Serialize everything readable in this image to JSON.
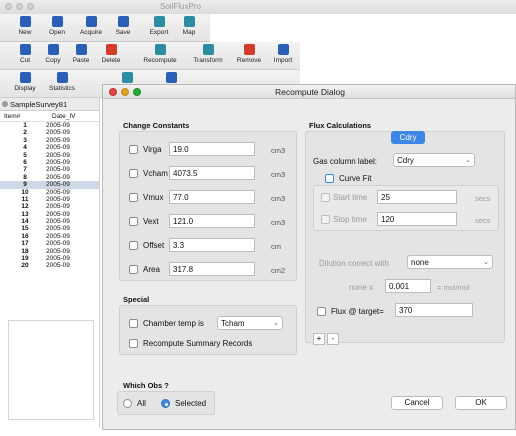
{
  "app": {
    "title": "SoilFluxPro"
  },
  "toolbar_row1": [
    {
      "label": "New",
      "icon": "new-file-icon"
    },
    {
      "label": "Open",
      "icon": "open-folder-icon"
    },
    {
      "label": "Acquire",
      "icon": "acquire-icon"
    },
    {
      "label": "Save",
      "icon": "save-icon"
    },
    {
      "label": "Export",
      "icon": "export-icon"
    },
    {
      "label": "Map",
      "icon": "map-icon"
    }
  ],
  "toolbar_row2": [
    {
      "label": "Cut",
      "icon": "scissors-icon"
    },
    {
      "label": "Copy",
      "icon": "copy-icon"
    },
    {
      "label": "Paste",
      "icon": "paste-icon"
    },
    {
      "label": "Delete",
      "icon": "delete-x-icon"
    },
    {
      "label": "Recompute",
      "icon": "recompute-icon"
    },
    {
      "label": "Transform",
      "icon": "transform-icon"
    },
    {
      "label": "Remove",
      "icon": "remove-icon"
    },
    {
      "label": "Import",
      "icon": "import-icon"
    }
  ],
  "toolbar_row3": [
    {
      "label": "Display",
      "icon": "pencil-icon"
    },
    {
      "label": "Statistics",
      "icon": "sigma-icon"
    }
  ],
  "sidebar": {
    "survey_tab": "SampleSurvey81",
    "columns": [
      "Item#",
      "Date_IV"
    ],
    "rows": [
      [
        "1",
        "2005-09"
      ],
      [
        "2",
        "2005-09"
      ],
      [
        "3",
        "2005-09"
      ],
      [
        "4",
        "2005-09"
      ],
      [
        "5",
        "2005-09"
      ],
      [
        "6",
        "2005-09"
      ],
      [
        "7",
        "2005-09"
      ],
      [
        "8",
        "2005-09"
      ],
      [
        "9",
        "2005-09"
      ],
      [
        "10",
        "2005-09"
      ],
      [
        "11",
        "2005-09"
      ],
      [
        "12",
        "2005-09"
      ],
      [
        "13",
        "2005-09"
      ],
      [
        "14",
        "2005-09"
      ],
      [
        "15",
        "2005-09"
      ],
      [
        "16",
        "2005-09"
      ],
      [
        "17",
        "2005-09"
      ],
      [
        "18",
        "2005-09"
      ],
      [
        "19",
        "2005-09"
      ],
      [
        "20",
        "2005-09"
      ]
    ],
    "selected_row": "9"
  },
  "dialog": {
    "title": "Recompute Dialog",
    "change_constants": {
      "label": "Change Constants",
      "items": [
        {
          "name": "Virga",
          "value": "19.0",
          "unit": "cm3"
        },
        {
          "name": "Vcham",
          "value": "4073.5",
          "unit": "cm3"
        },
        {
          "name": "Vmux",
          "value": "77.0",
          "unit": "cm3"
        },
        {
          "name": "Vext",
          "value": "121.0",
          "unit": "cm3"
        },
        {
          "name": "Offset",
          "value": "3.3",
          "unit": "cm"
        },
        {
          "name": "Area",
          "value": "317.8",
          "unit": "cm2"
        }
      ]
    },
    "special": {
      "label": "Special",
      "chamber_temp_label": "Chamber temp is",
      "chamber_temp_value": "Tcham",
      "recompute_summary_label": "Recompute Summary Records"
    },
    "flux": {
      "label": "Flux Calculations",
      "segment": "Cdry",
      "gas_column_label": "Gas column label:",
      "gas_column_value": "Cdry",
      "curve_fit_label": "Curve Fit",
      "start_time_label": "Start time",
      "start_time_value": "25",
      "stop_time_label": "Stop time",
      "stop_time_value": "120",
      "time_unit": "secs",
      "dilution_label": "Dilution correct with",
      "dilution_value": "none",
      "none_x_label": "none x",
      "none_x_value": "0.001",
      "none_x_unit": "= mol/mol",
      "flux_target_label": "Flux @ target=",
      "flux_target_value": "370",
      "plus": "+",
      "minus": "-"
    },
    "which_obs": {
      "label": "Which Obs ?",
      "options": [
        "All",
        "Selected"
      ],
      "selected": "Selected"
    },
    "cancel_label": "Cancel",
    "ok_label": "OK"
  },
  "colors": {
    "accent": "#3d86e8",
    "close": "#e0443e",
    "minimize": "#dea123",
    "zoom": "#27aa35"
  }
}
